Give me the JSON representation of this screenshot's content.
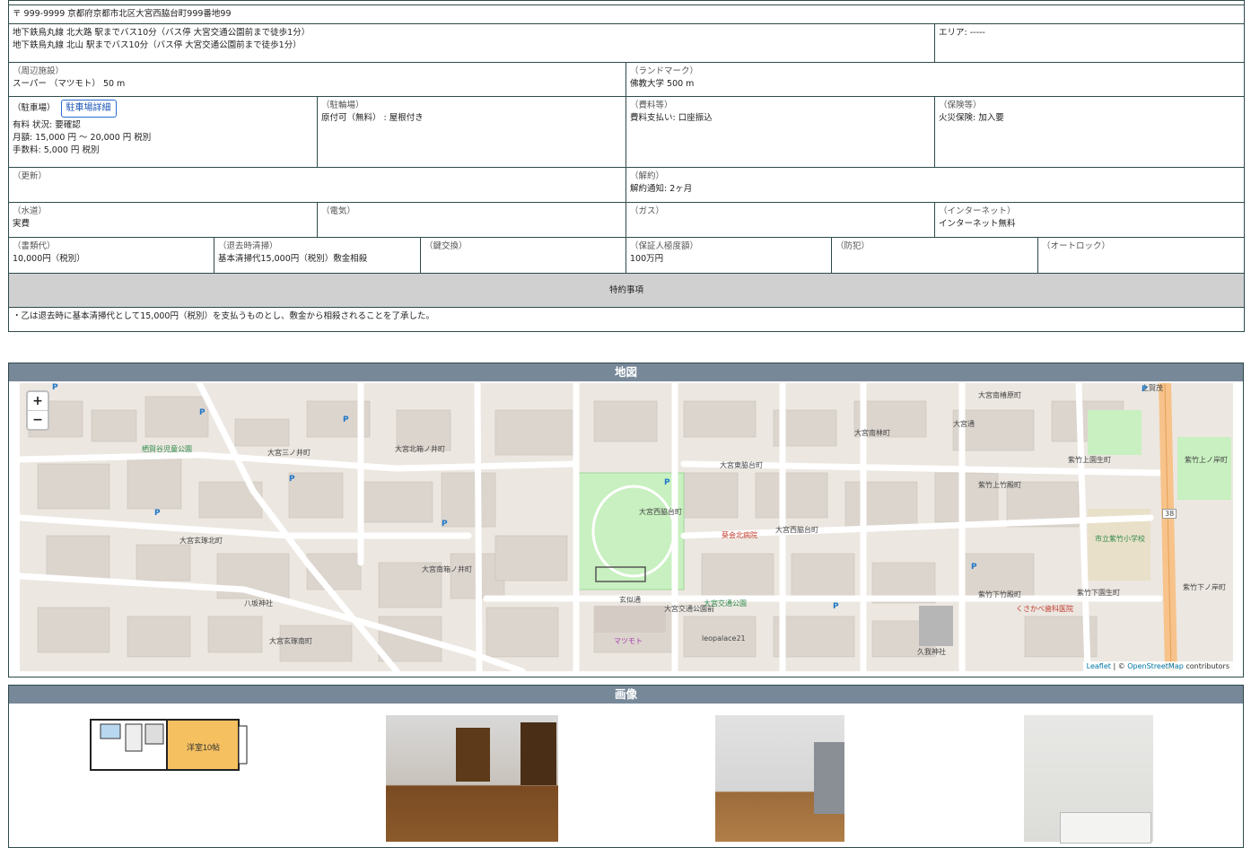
{
  "address": "〒 999-9999 京都府京都市北区大宮西脇台町999番地99",
  "access": {
    "line1": "地下鉄烏丸線 北大路 駅までバス10分（バス停 大宮交通公園前まで徒歩1分）",
    "line2": "地下鉄烏丸線 北山 駅までバス10分（バス停 大宮交通公園前まで徒歩1分）",
    "area": "エリア: -----"
  },
  "facilities": {
    "nearby_label": "（周辺施設）",
    "nearby_value": "スーパー （マツモト） 50 m",
    "landmark_label": "（ランドマーク）",
    "landmark_value": "佛教大学 500 m"
  },
  "row3": {
    "parking_label": "（駐車場）",
    "parking_button": "駐車場詳細",
    "parking_l1": "有料 状況: 要確認",
    "parking_l2": "月額: 15,000 円 ～ 20,000 円 税別",
    "parking_l3": "手数料: 5,000 円 税別",
    "bike_label": "（駐輪場）",
    "bike_value": "原付可（無料） : 屋根付き",
    "fees_label": "（費料等）",
    "fees_value": "費料支払い: 口座振込",
    "insurance_label": "（保険等）",
    "insurance_value": "火災保険: 加入要"
  },
  "row4": {
    "renewal_label": "（更新）",
    "renewal_value": "",
    "cancel_label": "（解約）",
    "cancel_value": "解約通知: 2ヶ月"
  },
  "row5": {
    "water_label": "（水道）",
    "water_value": "実費",
    "electric_label": "（電気）",
    "electric_value": "",
    "gas_label": "（ガス）",
    "gas_value": "",
    "internet_label": "（インターネット）",
    "internet_value": "インターネット無料"
  },
  "row6": {
    "docs_label": "（書類代）",
    "docs_value": "10,000円（税別）",
    "cleaning_label": "（退去時清掃）",
    "cleaning_value": "基本清掃代15,000円（税別）敷金相殺",
    "key_label": "（鍵交換）",
    "key_value": "",
    "guarantor_label": "（保証人極度額）",
    "guarantor_value": "100万円",
    "security_label": "（防犯）",
    "security_value": "",
    "autolock_label": "（オートロック）",
    "autolock_value": ""
  },
  "special": {
    "title": "特約事項",
    "text": "・乙は退去時に基本清掃代として15,000円（税別）を支払うものとし、敷金から相殺されることを了承した。"
  },
  "map": {
    "title": "地図",
    "zoom_in": "+",
    "zoom_out": "−",
    "attribution_leaflet": "Leaflet",
    "attribution_sep": " | © ",
    "attribution_osm": "OpenStreetMap",
    "attribution_tail": " contributors",
    "labels": {
      "l1": "大宮南椿原町",
      "l2": "大宮南林町",
      "l3": "大宮東脇台町",
      "l4": "大宮西脇台町",
      "l5": "大宮西脇台町",
      "l6": "紫竹上竹殿町",
      "l7": "紫竹上園生町",
      "l8": "紫竹上ノ岸町",
      "l9": "大宮北箱ノ井町",
      "l10": "大宮玄琢北町",
      "l11": "大宮南箱ノ井町",
      "l12": "大宮玄琢南町",
      "l13": "八坂神社",
      "l14": "久我神社",
      "l15": "玄似通",
      "l16": "大宮交通公園前",
      "l17": "葵会北病院",
      "l18": "紫竹下竹殿町",
      "l19": "紫竹下園生町",
      "l20": "市立紫竹小学校",
      "l21": "マツモト",
      "l22": "大宮交通公園",
      "l23": "大宮通",
      "l24": "leopalace21",
      "l25": "大宮三ノ井町",
      "l26": "栖賀谷児童公園",
      "l27": "38",
      "l28": "紫竹下ノ岸町",
      "l29": "上賀茂",
      "l30": "くさかべ歯科医院"
    }
  },
  "images": {
    "title": "画像",
    "floor_label": "洋室10帖"
  },
  "colors": {
    "header_bg": "#778899",
    "special_bg": "#d0d0d0",
    "border": "#2f4a4a"
  }
}
